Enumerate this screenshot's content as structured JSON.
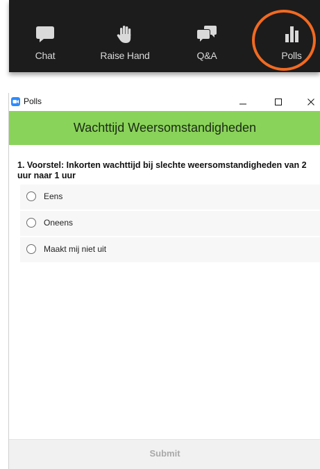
{
  "toolbar": {
    "background": "#1c1c1c",
    "highlight_color": "#f26a21",
    "buttons": [
      {
        "label": "Chat",
        "icon": "chat-bubble-icon"
      },
      {
        "label": "Raise Hand",
        "icon": "raise-hand-icon"
      },
      {
        "label": "Q&A",
        "icon": "qa-bubbles-icon"
      },
      {
        "label": "Polls",
        "icon": "bar-chart-icon"
      }
    ]
  },
  "window": {
    "title": "Polls",
    "app_icon": "zoom-app-icon",
    "controls": [
      "minimize-icon",
      "maximize-icon",
      "close-icon"
    ]
  },
  "poll": {
    "name": "Wachttijd Weersomstandigheden",
    "banner_color": "#8ad35a",
    "question": "1. Voorstel: Inkorten wachttijd bij slechte weersomstandigheden van 2 uur naar 1 uur",
    "options": [
      "Eens",
      "Oneens",
      "Maakt mij niet uit"
    ],
    "selected": null
  },
  "submit": {
    "label": "Submit",
    "enabled": false
  }
}
